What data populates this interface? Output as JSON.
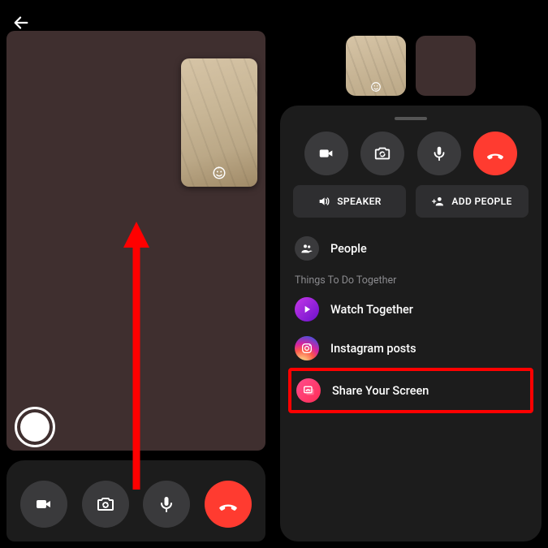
{
  "left": {
    "controls": {
      "video_icon": "video",
      "switch_icon": "camera-switch",
      "mic_icon": "microphone",
      "hangup_icon": "hangup"
    }
  },
  "right": {
    "controls": {
      "video_icon": "video",
      "switch_icon": "camera-switch",
      "mic_icon": "microphone",
      "hangup_icon": "hangup"
    },
    "buttons": {
      "speaker": "SPEAKER",
      "add_people": "ADD PEOPLE"
    },
    "people_label": "People",
    "section_label": "Things To Do Together",
    "items": {
      "watch": "Watch Together",
      "instagram": "Instagram posts",
      "screen": "Share Your Screen"
    }
  }
}
